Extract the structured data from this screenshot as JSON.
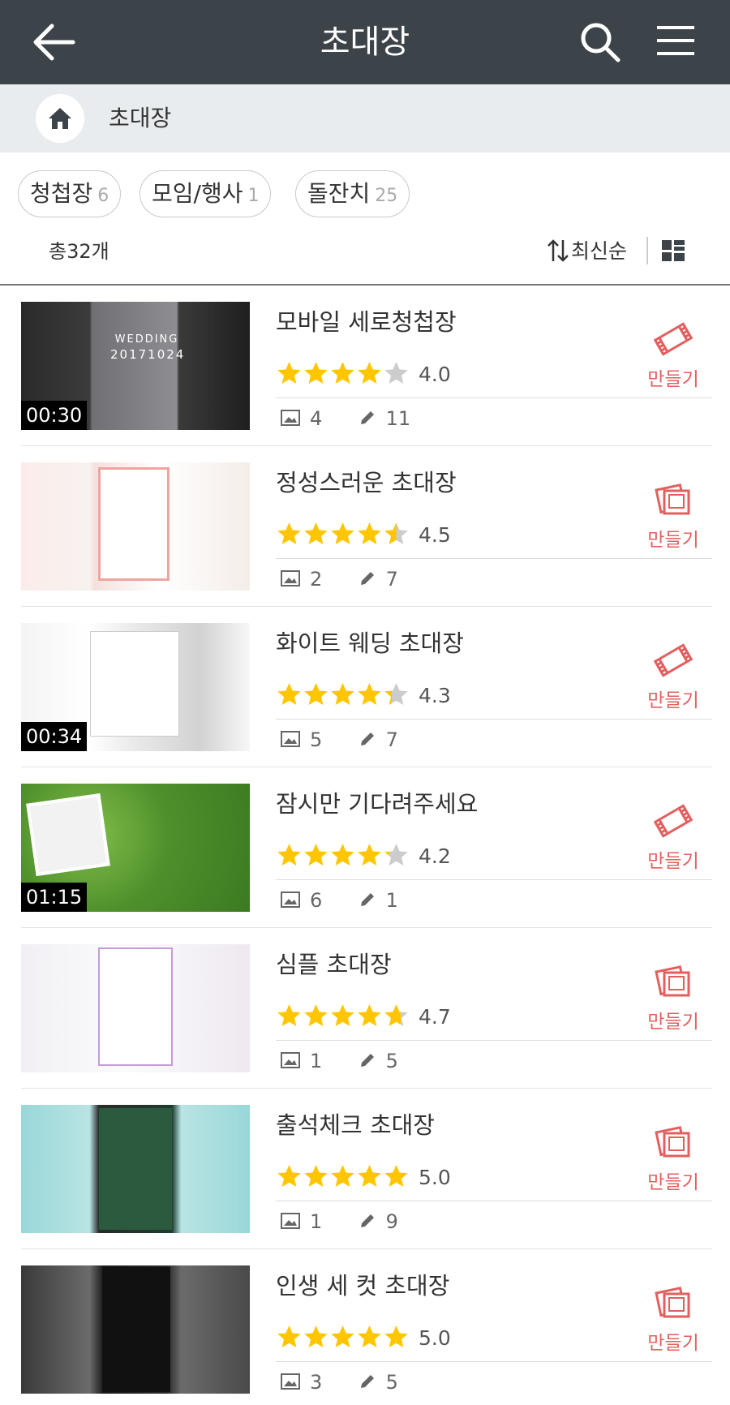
{
  "header": {
    "title": "초대장"
  },
  "breadcrumb": {
    "label": "초대장"
  },
  "filters": [
    {
      "label": "청첩장",
      "count": "6"
    },
    {
      "label": "모임/행사",
      "count": "1"
    },
    {
      "label": "돌잔치",
      "count": "25"
    }
  ],
  "list_header": {
    "total": "총32개",
    "sort": "최신순"
  },
  "make_label": "만들기",
  "items": [
    {
      "title": "모바일 세로청첩장",
      "rating": "4.0",
      "photos": "4",
      "edits": "11",
      "duration": "00:30",
      "stars": 4.0,
      "make_icon": "film-icon"
    },
    {
      "title": "정성스러운 초대장",
      "rating": "4.5",
      "photos": "2",
      "edits": "7",
      "duration": "",
      "stars": 4.5,
      "make_icon": "photos-icon"
    },
    {
      "title": "화이트 웨딩 초대장",
      "rating": "4.3",
      "photos": "5",
      "edits": "7",
      "duration": "00:34",
      "stars": 4.3,
      "make_icon": "film-icon"
    },
    {
      "title": "잠시만 기다려주세요",
      "rating": "4.2",
      "photos": "6",
      "edits": "1",
      "duration": "01:15",
      "stars": 4.2,
      "make_icon": "film-icon"
    },
    {
      "title": "심플 초대장",
      "rating": "4.7",
      "photos": "1",
      "edits": "5",
      "duration": "",
      "stars": 4.7,
      "make_icon": "photos-icon"
    },
    {
      "title": "출석체크 초대장",
      "rating": "5.0",
      "photos": "1",
      "edits": "9",
      "duration": "",
      "stars": 5.0,
      "make_icon": "photos-icon"
    },
    {
      "title": "인생 세 컷 초대장",
      "rating": "5.0",
      "photos": "3",
      "edits": "5",
      "duration": "",
      "stars": 5.0,
      "make_icon": "photos-icon"
    }
  ],
  "colors": {
    "header_bg": "#3d4449",
    "star": "#ffc600",
    "star_empty": "#cccccc",
    "accent": "#e35f5f"
  }
}
